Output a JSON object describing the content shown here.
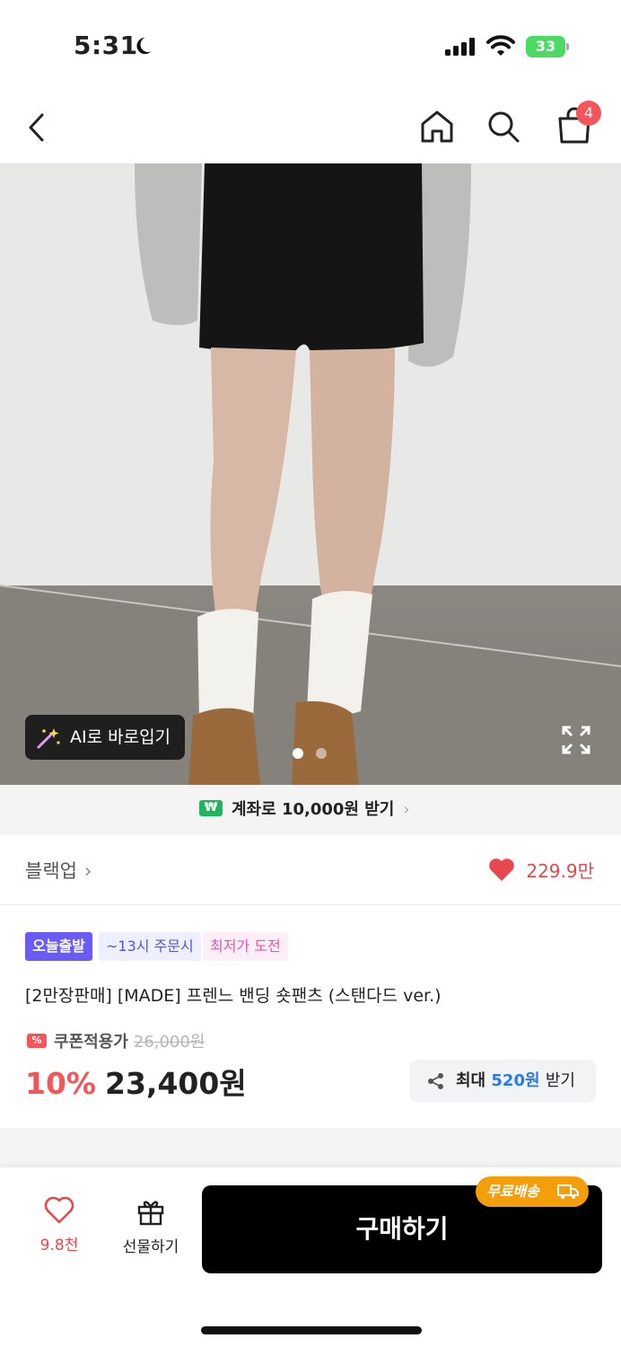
{
  "status_bar": {
    "time": "5:31",
    "battery": "33"
  },
  "header": {
    "cart_count": "4"
  },
  "hero": {
    "ai_button_label": "AI로 바로입기",
    "page_count": 2,
    "current_page": 1
  },
  "banner": {
    "icon_text": "₩",
    "text": "계좌로 10,000원 받기"
  },
  "brand": {
    "name": "블랙업",
    "likes": "229.9만"
  },
  "tags": [
    {
      "label": "오늘출발"
    },
    {
      "label": "~13시 주문시"
    },
    {
      "label": "최저가 도전"
    }
  ],
  "product": {
    "title": "[2만장판매] [MADE] 프렌느 밴딩 숏팬츠 (스탠다드 ver.)",
    "coupon_label": "쿠폰적용가",
    "original_price": "26,000원",
    "discount": "10%",
    "price": "23,400원"
  },
  "share": {
    "prefix": "최대",
    "amount": "520원",
    "suffix": "받기"
  },
  "bottom_bar": {
    "wish_count": "9.8천",
    "gift_label": "선물하기",
    "buy_label": "구매하기",
    "free_shipping": "무료배송"
  },
  "colors": {
    "accent_red": "#f2565a",
    "tag_purple": "#6b5bf5",
    "shipping_orange": "#f59e0b",
    "link_blue": "#2c7be5"
  }
}
